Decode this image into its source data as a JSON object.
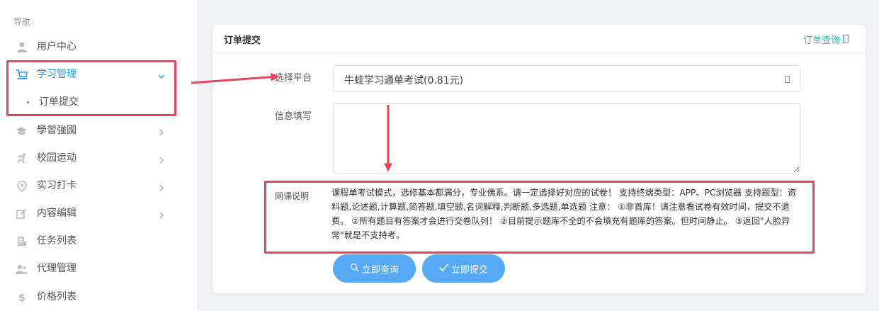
{
  "sidebar": {
    "heading": "导航",
    "items": [
      {
        "label": "用户中心",
        "icon": "user-icon"
      },
      {
        "label": "学习管理",
        "icon": "cart-icon"
      },
      {
        "label": "學習強國",
        "icon": "graduation-cap-icon"
      },
      {
        "label": "校园运动",
        "icon": "running-icon"
      },
      {
        "label": "实习打卡",
        "icon": "location-pin-icon"
      },
      {
        "label": "内容编辑",
        "icon": "edit-icon"
      },
      {
        "label": "任务列表",
        "icon": "task-list-icon"
      },
      {
        "label": "代理管理",
        "icon": "agents-icon"
      },
      {
        "label": "价格列表",
        "icon": "dollar-icon"
      }
    ],
    "sub_items": [
      {
        "label": "订单提交"
      }
    ]
  },
  "card": {
    "title": "订单提交",
    "query_link": "订单查询"
  },
  "form": {
    "platform_label": "选择平台",
    "platform_value": "牛蛙学习通单考试(0.81元)",
    "info_label": "信息填写",
    "info_value": "",
    "notice_label": "网课说明",
    "notice_text": "课程单考试模式，选修基本都满分，专业佛系。请一定选择好对应的试卷！ 支持终端类型：APP、PC浏览器 支持题型：资料题,论述题,计算题,简答题,填空题,名词解释,判断题,多选题,单选题 注意： ①非首库！请注意看试卷有效时间，提交不退费。 ②所有题目有答案才会进行交卷队列！ ②目前提示题库不全的不会填充有题库的答案。但时间静止。 ③返回\"人脸异常\"就是不支持考。"
  },
  "buttons": {
    "query": "立即查询",
    "submit": "立即提交"
  },
  "colors": {
    "accent": "#1e9fff",
    "button": "#55a9f5",
    "link": "#2dbfb0",
    "annotation": "#e8455a"
  }
}
